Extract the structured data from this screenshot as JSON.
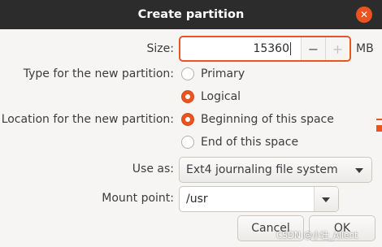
{
  "dialog": {
    "title": "Create partition",
    "close_glyph": "✕"
  },
  "size": {
    "label": "Size:",
    "value": "15360",
    "minus": "−",
    "plus": "+",
    "unit": "MB"
  },
  "type": {
    "label": "Type for the new partition:",
    "options": [
      {
        "label": "Primary",
        "checked": false
      },
      {
        "label": "Logical",
        "checked": true
      }
    ]
  },
  "location": {
    "label": "Location for the new partition:",
    "options": [
      {
        "label": "Beginning of this space",
        "checked": true
      },
      {
        "label": "End of this space",
        "checked": false
      }
    ]
  },
  "use_as": {
    "label": "Use as:",
    "value": "Ext4 journaling file system"
  },
  "mount_point": {
    "label": "Mount point:",
    "value": "/usr"
  },
  "buttons": {
    "cancel": "Cancel",
    "ok": "OK"
  },
  "watermark": "CSDN @小壮_Allent",
  "colors": {
    "accent": "#e95420",
    "titlebar": "#2c2c2c",
    "background": "#f6f5f4"
  }
}
